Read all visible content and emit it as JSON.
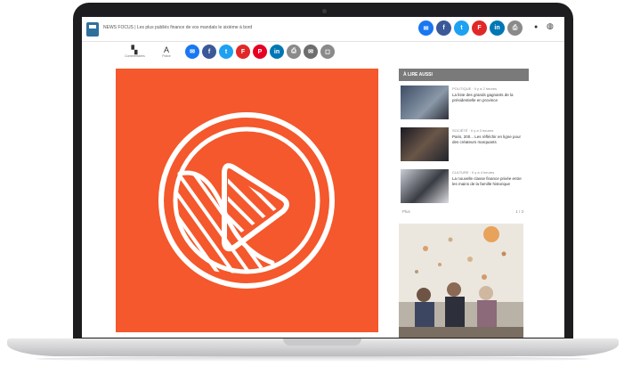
{
  "article": {
    "headline": "NEWS FOCUS | Les plus publiés finance de vos mandats le sixième à bord",
    "hero_media": "play-button-illustration"
  },
  "share_top": [
    {
      "icon": "messenger-icon",
      "color": "#1877f2"
    },
    {
      "icon": "facebook-icon",
      "color": "#3b5998"
    },
    {
      "icon": "twitter-icon",
      "color": "#1da1f2"
    },
    {
      "icon": "flipboard-icon",
      "color": "#e12828"
    },
    {
      "icon": "linkedin-icon",
      "color": "#0077b5"
    },
    {
      "icon": "print-icon",
      "color": "#8a8a8a"
    }
  ],
  "share_mid": [
    {
      "icon": "messenger-icon",
      "color": "#1877f2"
    },
    {
      "icon": "facebook-icon",
      "color": "#3b5998"
    },
    {
      "icon": "twitter-icon",
      "color": "#1da1f2"
    },
    {
      "icon": "flipboard-icon",
      "color": "#e12828"
    },
    {
      "icon": "pinterest-icon",
      "color": "#e60023"
    },
    {
      "icon": "linkedin-icon",
      "color": "#0077b5"
    },
    {
      "icon": "print-icon",
      "color": "#8a8a8a"
    },
    {
      "icon": "email-icon",
      "color": "#6d6d6d"
    },
    {
      "icon": "save-icon",
      "color": "#8a8a8a"
    }
  ],
  "toolbar": {
    "comments_label": "Commentaires",
    "font_label": "Police"
  },
  "sidebar": {
    "heading": "À LIRE AUSSI",
    "items": [
      {
        "category": "POLITIQUE · Il y a 2 heures",
        "title": "La liste des grands gagnants de la présidentielle en province"
      },
      {
        "category": "SOCIÉTÉ · Il y a 3 heures",
        "title": "Paris, 200... Les réfléchir en ligne pour des créateurs marquants"
      },
      {
        "category": "CULTURE · Il y a 4 heures",
        "title": "La nouvelle classe finance privée entre les mains de la famille historique"
      }
    ],
    "pager_left": "Plus",
    "pager_right": "1 / 3"
  },
  "colors": {
    "hero_bg": "#f4582c",
    "sidebar_head": "#7a7a7a"
  }
}
